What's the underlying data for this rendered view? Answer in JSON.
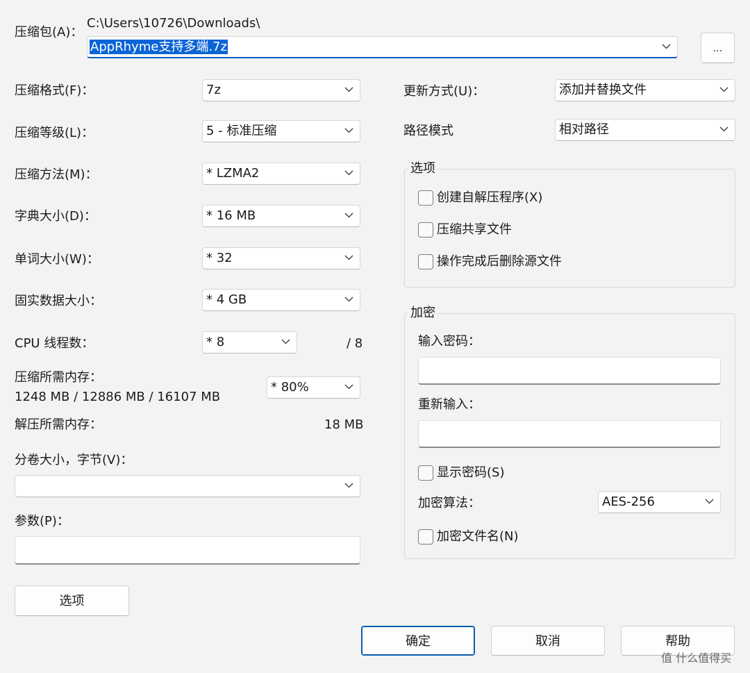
{
  "archive": {
    "label": "压缩包(A)：",
    "path": "C:\\Users\\10726\\Downloads\\",
    "filename": "AppRhyme支持多端.7z",
    "browse_label": "..."
  },
  "left": {
    "format_label": "压缩格式(F)：",
    "format_value": "7z",
    "level_label": "压缩等级(L)：",
    "level_value": "5 - 标准压缩",
    "method_label": "压缩方法(M)：",
    "method_value": "*  LZMA2",
    "dict_label": "字典大小(D)：",
    "dict_value": "*  16 MB",
    "word_label": "单词大小(W)：",
    "word_value": "*  32",
    "solid_label": "固实数据大小：",
    "solid_value": "*  4 GB",
    "cpu_label": "CPU 线程数：",
    "cpu_value": "*  8",
    "cpu_total": "/ 8",
    "mem_label": "压缩所需内存：",
    "mem_values": "1248 MB / 12886 MB / 16107 MB",
    "mem_percent": "*  80%",
    "decomp_label": "解压所需内存：",
    "decomp_value": "18 MB",
    "split_label": "分卷大小，字节(V)：",
    "split_value": "",
    "params_label": "参数(P)：",
    "params_value": "",
    "options_button": "选项"
  },
  "right": {
    "update_label": "更新方式(U)：",
    "update_value": "添加并替换文件",
    "path_label": "路径模式",
    "path_value": "相对路径",
    "options_group": {
      "title": "选项",
      "items": [
        {
          "label": "创建自解压程序(X)",
          "checked": false
        },
        {
          "label": "压缩共享文件",
          "checked": false
        },
        {
          "label": "操作完成后删除源文件",
          "checked": false
        }
      ]
    },
    "encryption": {
      "title": "加密",
      "password_label": "输入密码：",
      "reenter_label": "重新输入：",
      "show_password": "显示密码(S)",
      "method_label": "加密算法：",
      "method_value": "AES-256",
      "encrypt_names": "加密文件名(N)"
    }
  },
  "buttons": {
    "ok": "确定",
    "cancel": "取消",
    "help": "帮助"
  },
  "watermark": "值 什么值得买"
}
